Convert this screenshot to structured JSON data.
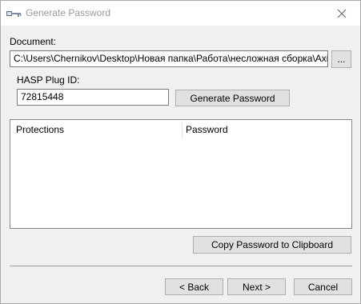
{
  "window": {
    "title": "Generate Password",
    "icon": "key-icon",
    "close_icon": "close-icon"
  },
  "document": {
    "label": "Document:",
    "path": "C:\\Users\\Chernikov\\Desktop\\Новая папка\\Работа\\несложная сборка\\Axis.grb",
    "browse_label": "..."
  },
  "hasp": {
    "label": "HASP Plug ID:",
    "value": "72815448",
    "generate_label": "Generate Password"
  },
  "table": {
    "columns": [
      "Protections",
      "Password"
    ],
    "rows": []
  },
  "copy_label": "Copy Password to Clipboard",
  "footer": {
    "back_label": "< Back",
    "next_label": "Next >",
    "cancel_label": "Cancel"
  }
}
